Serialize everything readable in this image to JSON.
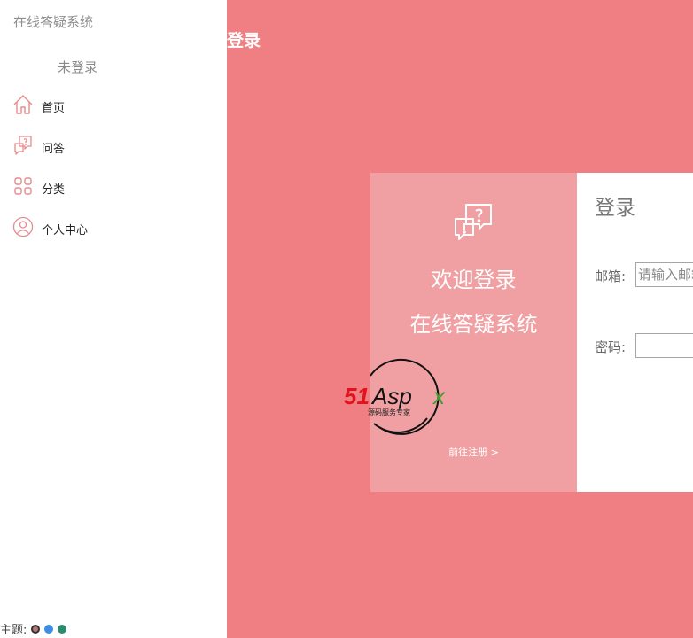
{
  "sidebar": {
    "app_title": "在线答疑系统",
    "user_status": "未登录",
    "nav": [
      {
        "label": "首页",
        "icon": "home-icon"
      },
      {
        "label": "问答",
        "icon": "qa-icon"
      },
      {
        "label": "分类",
        "icon": "category-icon"
      },
      {
        "label": "个人中心",
        "icon": "user-icon"
      }
    ],
    "theme": {
      "label": "主题:",
      "options": [
        "#b97474",
        "#3b8ee0",
        "#2d8a6e"
      ]
    }
  },
  "header": {
    "title": "登录"
  },
  "login": {
    "welcome_line1": "欢迎登录",
    "welcome_line2": "在线答疑系统",
    "register_link": "前往注册 >",
    "form_title": "登录",
    "email_label": "邮箱:",
    "email_placeholder": "请输入邮箱",
    "password_label": "密码:",
    "password_value": ""
  },
  "watermark": {
    "brand": "51Aspx",
    "tagline": "源码服务专家"
  },
  "colors": {
    "accent": "#ef7f82",
    "panel": "#f0a0a2",
    "icon": "#e88a8d"
  }
}
